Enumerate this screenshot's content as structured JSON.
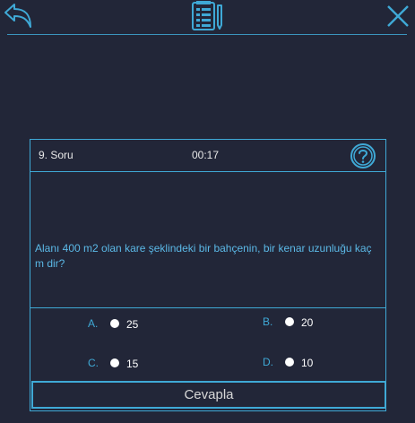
{
  "header": {
    "back_icon": "back-arrow-icon",
    "logo_icon": "notepad-pencil-icon",
    "close_icon": "close-icon"
  },
  "question": {
    "number_label": "9. Soru",
    "timer": "00:17",
    "help_icon": "question-mark-icon",
    "text": "Alanı 400 m2 olan kare şeklindeki bir bahçenin, bir kenar uzunluğu kaç m dir?"
  },
  "options": [
    {
      "letter": "A.",
      "value": "25"
    },
    {
      "letter": "B.",
      "value": "20"
    },
    {
      "letter": "C.",
      "value": "15"
    },
    {
      "letter": "D.",
      "value": "10"
    }
  ],
  "submit_label": "Cevapla",
  "colors": {
    "background": "#222638",
    "accent": "#3fa9d6",
    "question_text": "#5bb8e6"
  }
}
